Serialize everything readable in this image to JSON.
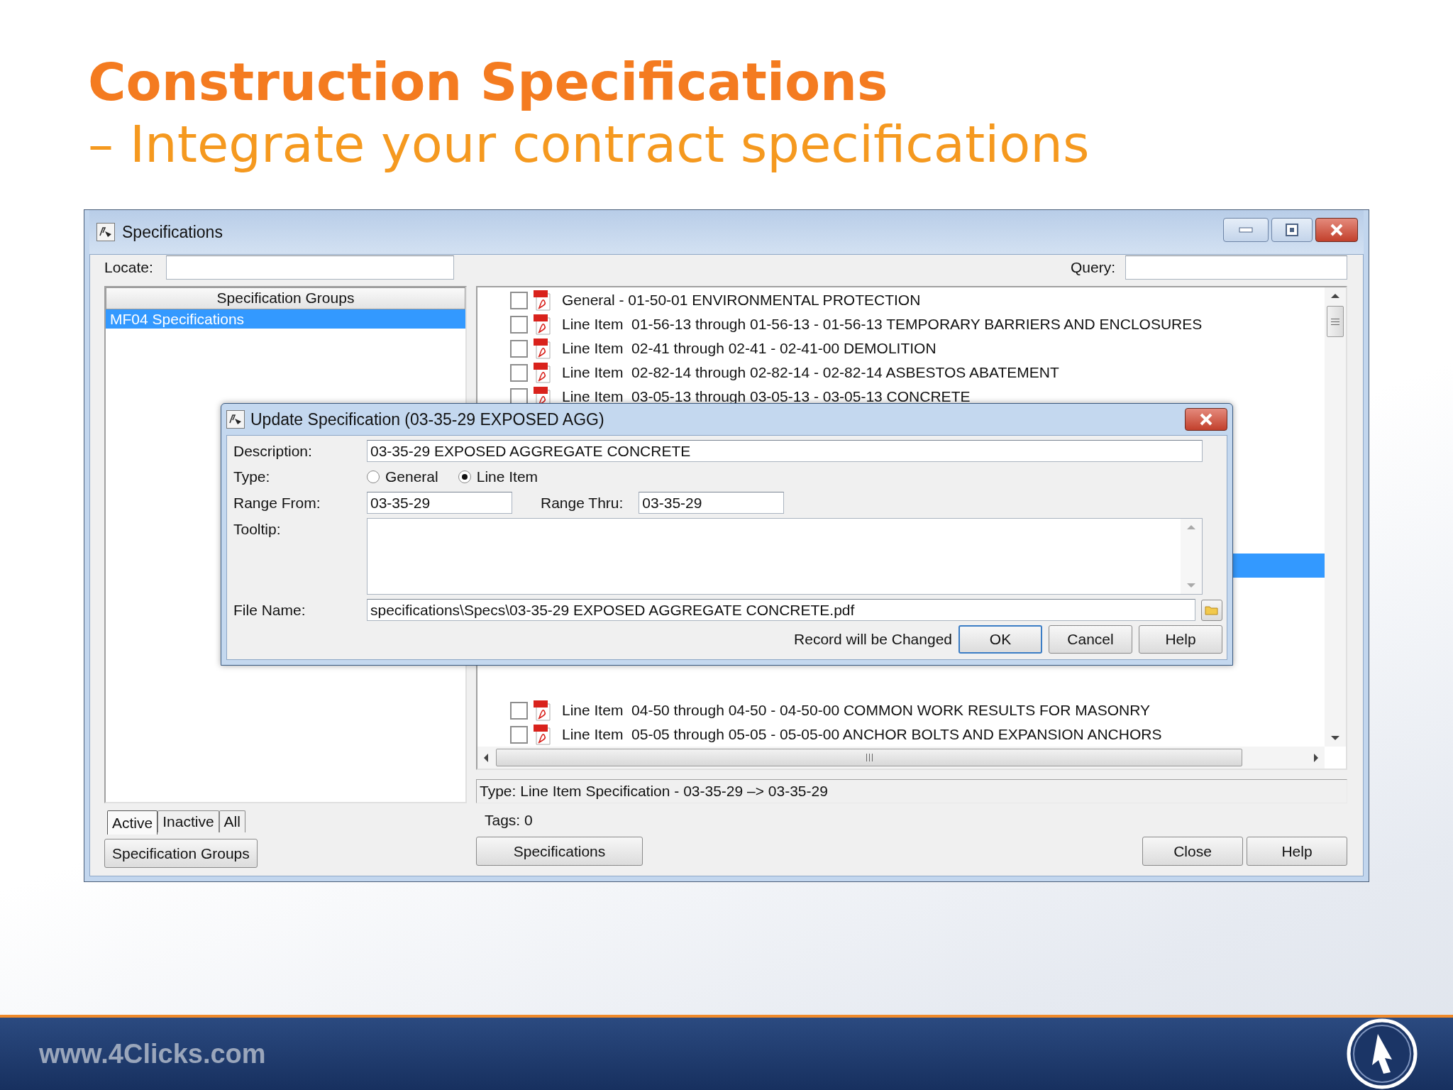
{
  "slide": {
    "title": "Construction Specifications",
    "subtitle": "– Integrate your contract specifications"
  },
  "window": {
    "title": "Specifications",
    "locate_label": "Locate:",
    "query_label": "Query:",
    "groups": {
      "header": "Specification Groups",
      "items": [
        {
          "label": "MF04 Specifications",
          "selected": true
        }
      ]
    },
    "group_filters": [
      {
        "label": "Active",
        "selected": true
      },
      {
        "label": "Inactive",
        "selected": false
      },
      {
        "label": "All",
        "selected": false
      }
    ],
    "group_button": "Specification Groups",
    "specs": [
      {
        "kind": "row",
        "label": "General - 01-50-01 ENVIRONMENTAL PROTECTION",
        "checked": false
      },
      {
        "kind": "row",
        "label": "Line Item  01-56-13 through 01-56-13 - 01-56-13 TEMPORARY BARRIERS AND ENCLOSURES",
        "checked": false
      },
      {
        "kind": "row",
        "label": "Line Item  02-41 through 02-41 - 02-41-00 DEMOLITION",
        "checked": false
      },
      {
        "kind": "row",
        "label": "Line Item  02-82-14 through 02-82-14 - 02-82-14 ASBESTOS ABATEMENT",
        "checked": false
      },
      {
        "kind": "row",
        "label": "Line Item  03-05-13 through 03-05-13 - 03-05-13 CONCRETE",
        "checked": false
      },
      {
        "kind": "covered",
        "selected": false
      },
      {
        "kind": "covered",
        "selected": false
      },
      {
        "kind": "covered",
        "selected": false
      },
      {
        "kind": "covered",
        "selected": false
      },
      {
        "kind": "covered",
        "selected": false
      },
      {
        "kind": "covered",
        "selected": false
      },
      {
        "kind": "covered",
        "selected": true
      },
      {
        "kind": "covered",
        "selected": false
      },
      {
        "kind": "covered",
        "selected": false
      },
      {
        "kind": "covered",
        "selected": false
      },
      {
        "kind": "covered",
        "selected": false
      },
      {
        "kind": "covered",
        "selected": false
      },
      {
        "kind": "row",
        "label": "Line Item  04-50 through 04-50 - 04-50-00 COMMON WORK RESULTS FOR MASONRY",
        "checked": false
      },
      {
        "kind": "row",
        "label": "Line Item  05-05 through 05-05 - 05-05-00 ANCHOR BOLTS AND EXPANSION ANCHORS",
        "checked": false
      }
    ],
    "status": "Type: Line Item Specification - 03-35-29 –> 03-35-29",
    "tags": "Tags: 0",
    "specs_button": "Specifications",
    "buttons": [
      "Close",
      "Help"
    ]
  },
  "dialog": {
    "title": "Update Specification (03-35-29 EXPOSED AGG)",
    "description_label": "Description:",
    "description": "03-35-29 EXPOSED AGGREGATE CONCRETE",
    "type_label": "Type:",
    "types": [
      {
        "label": "General",
        "selected": false
      },
      {
        "label": "Line Item",
        "selected": true
      }
    ],
    "range_from_label": "Range From:",
    "range_from": "03-35-29",
    "range_thru_label": "Range Thru:",
    "range_thru": "03-35-29",
    "tooltip_label": "Tooltip:",
    "file_label": "File Name:",
    "file_name": "specifications\\Specs\\03-35-29 EXPOSED AGGREGATE CONCRETE.pdf",
    "message": "Record will be Changed",
    "buttons": [
      {
        "label": "OK",
        "default": true
      },
      {
        "label": "Cancel",
        "default": false
      },
      {
        "label": "Help",
        "default": false
      }
    ]
  },
  "footer": {
    "url": "www.4Clicks.com"
  }
}
